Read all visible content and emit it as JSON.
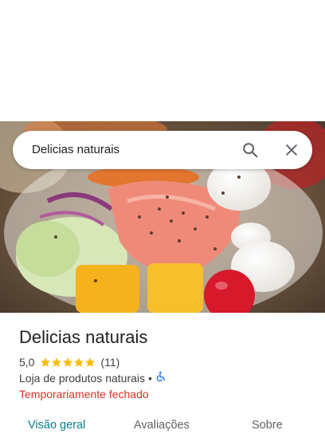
{
  "search": {
    "query": "Delicias naturais",
    "search_icon": "search-icon",
    "close_icon": "close-icon"
  },
  "photo": {
    "subject": "poke-bowl-photo"
  },
  "place": {
    "name": "Delicias naturais",
    "rating": "5,0",
    "stars": 5,
    "reviews_count": "(11)",
    "category": "Loja de produtos naturais",
    "separator": "•",
    "accessibility_icon": "wheelchair-icon",
    "status": "Temporariamente fechado"
  },
  "tabs": [
    {
      "label": "Visão geral",
      "active": true
    },
    {
      "label": "Avaliações",
      "active": false
    },
    {
      "label": "Sobre",
      "active": false
    }
  ],
  "colors": {
    "star": "#fbbc04",
    "status": "#d93025",
    "active_tab": "#0b7f8a",
    "accessibility": "#1a73e8"
  }
}
